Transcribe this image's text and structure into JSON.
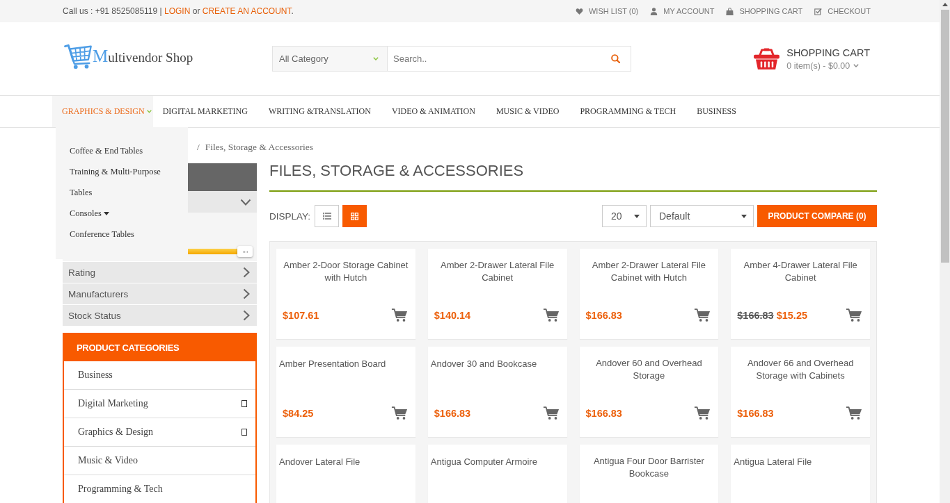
{
  "top_bar": {
    "contact": [
      {
        "kind": "text",
        "text": "Call us : +91 8525085119 |"
      },
      {
        "kind": "link",
        "text": "LOGIN"
      },
      {
        "kind": "text",
        "text": "or"
      },
      {
        "kind": "link",
        "text": "CREATE AN ACCOUNT"
      },
      {
        "kind": "punct",
        "text": "."
      }
    ],
    "links": [
      {
        "kind": "wishlist",
        "label": "WISH LIST (0)"
      },
      {
        "kind": "account",
        "label": "MY ACCOUNT"
      },
      {
        "kind": "cart",
        "label": "SHOPPING CART"
      },
      {
        "kind": "checkout",
        "label": "CHECKOUT"
      }
    ]
  },
  "header": {
    "logo": "Multivendor Shop",
    "search": {
      "category": "All Category",
      "placeholder": "Search.."
    },
    "cart": {
      "title": "SHOPPING CART",
      "summary": "0 item(s) - $0.00"
    }
  },
  "nav": {
    "items": [
      {
        "label": "GRAPHICS & DESIGN",
        "selected": true,
        "expanded": true,
        "menu": [
          {
            "label": "Coffee & End Tables",
            "has_submenu": false
          },
          {
            "label": "Training & Multi-Purpose",
            "has_submenu": false
          },
          {
            "label": "Tables",
            "has_submenu": false
          },
          {
            "label": "Consoles",
            "has_submenu": true
          },
          {
            "label": "Conference Tables",
            "has_submenu": false
          }
        ]
      },
      {
        "label": "DIGITAL MARKETING",
        "selected": false,
        "expanded": false
      },
      {
        "label": "WRITING &TRANSLATION",
        "selected": false,
        "expanded": false
      },
      {
        "label": "VIDEO & ANIMATION",
        "selected": false,
        "expanded": false
      },
      {
        "label": "MUSIC & VIDEO",
        "selected": false,
        "expanded": false
      },
      {
        "label": "PROGRAMMING & TECH",
        "selected": false,
        "expanded": false
      },
      {
        "label": "BUSINESS",
        "selected": false,
        "expanded": false
      }
    ]
  },
  "breadcrumb": {
    "separator": "/",
    "current": "Files, Storage & Accessories"
  },
  "sidebar": {
    "filters": [
      {
        "expanded": true,
        "slider": {
          "level": 1
        }
      },
      {
        "label": "Rating",
        "expanded": false
      },
      {
        "label": "Manufacturers",
        "expanded": false
      },
      {
        "label": "Stock Status",
        "expanded": false
      }
    ],
    "categories": {
      "title": "PRODUCT CATEGORIES",
      "items": [
        {
          "label": "Business",
          "has_children": false
        },
        {
          "label": "Digital Marketing",
          "has_children": true
        },
        {
          "label": "Graphics & Design",
          "has_children": true
        },
        {
          "label": "Music & Video",
          "has_children": false
        },
        {
          "label": "Programming & Tech",
          "has_children": false
        }
      ]
    }
  },
  "main": {
    "title": "FILES, STORAGE & ACCESSORIES",
    "display": {
      "label": "DISPLAY:",
      "views": [
        {
          "kind": "list",
          "selected": false
        },
        {
          "kind": "grid",
          "selected": true
        }
      ]
    },
    "limit": {
      "value": "20"
    },
    "sort": {
      "value": "Default"
    },
    "compare_button": "PRODUCT COMPARE (0)",
    "products": [
      {
        "name": "Amber 2-Door Storage Cabinet with Hutch",
        "price": "$107.61"
      },
      {
        "name": "Amber 2-Drawer Lateral File Cabinet",
        "price": "$140.14"
      },
      {
        "name": "Amber 2-Drawer Lateral File Cabinet with Hutch",
        "price": "$166.83"
      },
      {
        "name": "Amber 4-Drawer Lateral File Cabinet",
        "old_price": "$166.83",
        "price": "$15.25"
      },
      {
        "name": "Amber Presentation Board",
        "price": "$84.25"
      },
      {
        "name": "Andover 30 and Bookcase",
        "price": "$166.83"
      },
      {
        "name": "Andover 60 and Overhead Storage",
        "price": "$166.83"
      },
      {
        "name": "Andover 66 and Overhead Storage with Cabinets",
        "price": "$166.83"
      },
      {
        "name": "Andover Lateral File"
      },
      {
        "name": "Antigua Computer Armoire"
      },
      {
        "name": "Antigua Four Door Barrister Bookcase"
      },
      {
        "name": "Antigua Lateral File"
      }
    ]
  }
}
